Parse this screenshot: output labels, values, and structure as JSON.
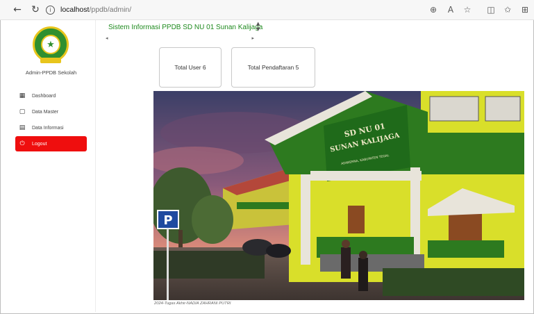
{
  "browser": {
    "url_host": "localhost",
    "url_path": "/ppdb/admin/",
    "icons": [
      "back-arrow-icon",
      "reload-icon",
      "info-icon",
      "zoom-icon",
      "read-aloud-icon",
      "favorite-star-icon",
      "split-screen-icon",
      "favorites-icon",
      "extensions-icon"
    ]
  },
  "sidebar": {
    "admin_name": "Admin-PPDB Sekolah",
    "items": [
      {
        "label": "Dashboard",
        "icon": "dashboard-icon"
      },
      {
        "label": "Data Master",
        "icon": "file-icon"
      },
      {
        "label": "Data Informasi",
        "icon": "document-icon"
      },
      {
        "label": "Logout",
        "icon": "power-icon"
      }
    ]
  },
  "header": {
    "title": "Sistem Informasi PPDB SD NU 01 Sunan Kalijaga"
  },
  "stats": {
    "total_user": "Total User 6",
    "total_pendaftaran": "Total Pendaftaran 5"
  },
  "hero": {
    "sign_line1": "SD NU 01",
    "sign_line2": "SUNAN KALIJAGA",
    "sign_line3": "ADIWERNA, KABUPATEN TEGAL",
    "parking": "P",
    "caption": "2024-Tugas Akhir-NADIA ZAHRANI PUTRI"
  },
  "colors": {
    "accent_green": "#1e8a1e",
    "logout_red": "#ef0e0e",
    "building_green": "#2d7a1f",
    "building_yellow": "#d9df2a"
  }
}
